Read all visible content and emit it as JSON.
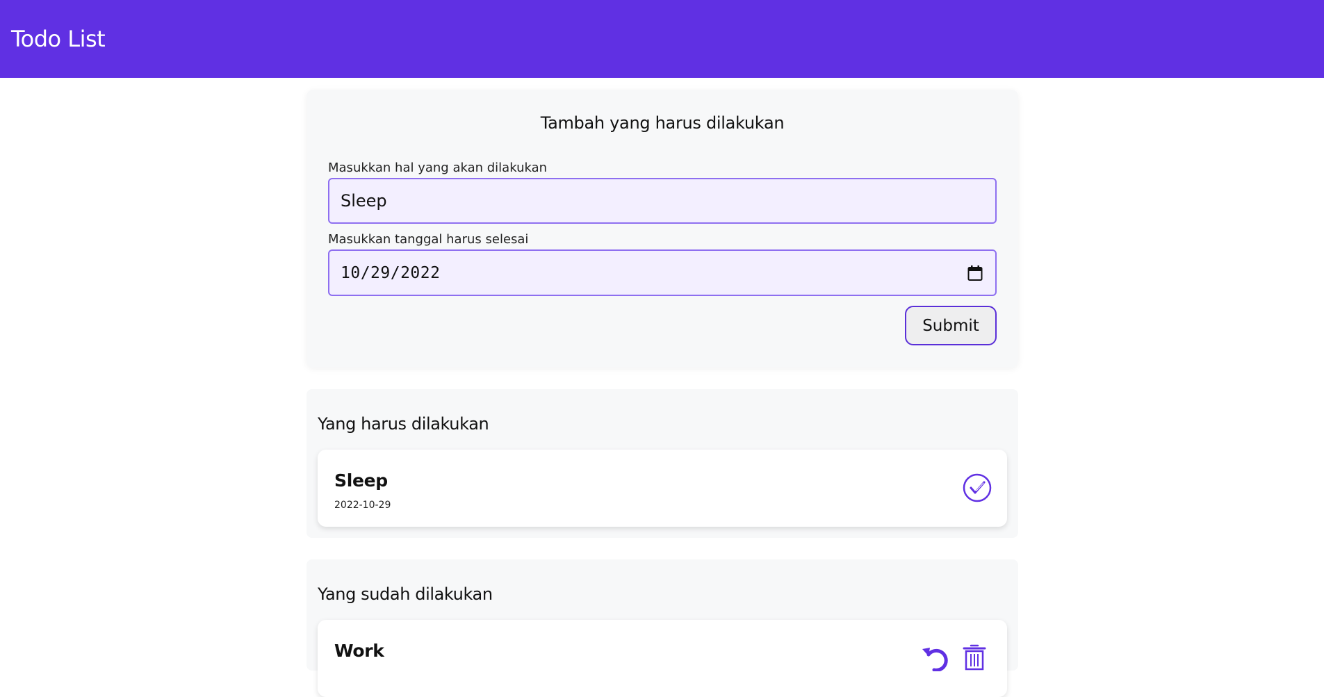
{
  "header": {
    "title": "Todo List"
  },
  "form": {
    "title": "Tambah yang harus dilakukan",
    "task_label": "Masukkan hal yang akan dilakukan",
    "task_value": "Sleep",
    "date_label": "Masukkan tanggal harus selesai",
    "date_value": "10/29/2022",
    "submit_label": "Submit"
  },
  "todo": {
    "title": "Yang harus dilakukan",
    "items": [
      {
        "title": "Sleep",
        "date": "2022-10-29"
      }
    ]
  },
  "done": {
    "title": "Yang sudah dilakukan",
    "items": [
      {
        "title": "Work"
      }
    ]
  },
  "icons": {
    "check": "check-circle-icon",
    "undo": "undo-icon",
    "trash": "trash-icon",
    "calendar": "calendar-icon"
  },
  "colors": {
    "accent": "#6030e3",
    "input_bg": "#f3efff",
    "input_border": "#8e6ff0",
    "card_bg": "#f7f8f9"
  }
}
